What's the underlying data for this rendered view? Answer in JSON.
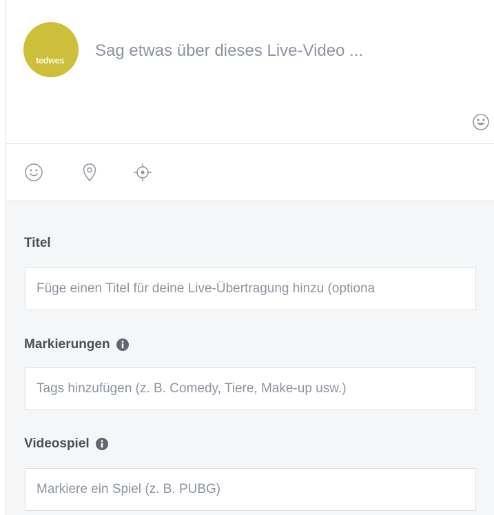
{
  "composer": {
    "avatar_logo_text": "tedwes",
    "status_placeholder": "Sag etwas über dieses Live-Video ..."
  },
  "actions": {
    "icons": [
      "smiley-icon",
      "location-pin-icon",
      "crosshair-icon"
    ]
  },
  "form": {
    "title": {
      "label": "Titel",
      "placeholder": "Füge einen Titel für deine Live-Übertragung hinzu (optiona"
    },
    "tags": {
      "label": "Markierungen",
      "placeholder": "Tags hinzufügen (z. B. Comedy, Tiere, Make-up usw.)"
    },
    "game": {
      "label": "Videospiel",
      "placeholder": "Markiere ein Spiel (z. B. PUBG)"
    }
  },
  "colors": {
    "avatar": "#cdbf3a",
    "form_background": "#f5f6f7",
    "border": "#dddfe2",
    "placeholder": "#8d949e",
    "label": "#4b4f56"
  }
}
